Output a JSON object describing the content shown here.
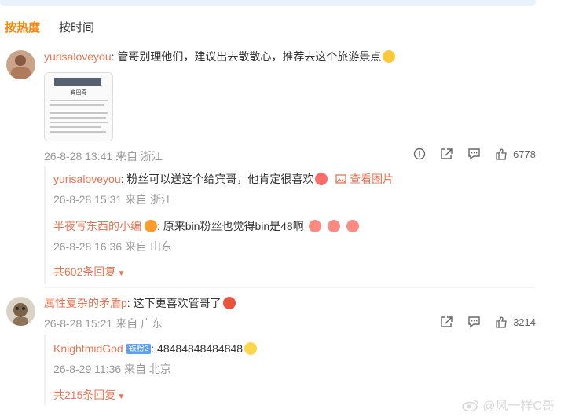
{
  "sort": {
    "hot": "按热度",
    "time": "按时间"
  },
  "comments": [
    {
      "user": "yurisaloveyou",
      "text": ": 管哥别理他们，建议出去散散心，推荐去这个旅游景点",
      "image_title": "宾巴奇",
      "time": "26-8-28 13:41",
      "source": "来自 浙江",
      "likes": "6778",
      "replies": [
        {
          "user": "yurisaloveyou",
          "text": ": 粉丝可以送这个给宾哥，他肯定很喜欢",
          "view_image": "查看图片",
          "time": "26-8-28 15:31",
          "source": "来自 浙江"
        },
        {
          "user": "半夜写东西的小编",
          "text": ": 原来bin粉丝也觉得bin是48啊",
          "time": "26-8-28 16:36",
          "source": "来自 山东"
        }
      ],
      "more": "共602条回复"
    },
    {
      "user": "属性复杂的矛盾p",
      "text": ": 这下更喜欢管哥了",
      "time": "26-8-28 15:21",
      "source": "来自 广东",
      "likes": "3214",
      "replies": [
        {
          "user": "KnightmidGod",
          "badge": "铁粉2",
          "text": ": 48484848484848",
          "time": "26-8-29 11:36",
          "source": "来自 北京"
        }
      ],
      "more": "共215条回复"
    }
  ],
  "watermark": "@风一样C哥",
  "colors": {
    "accent": "#ff8200",
    "name": "#eb7350",
    "meta": "#999999"
  }
}
